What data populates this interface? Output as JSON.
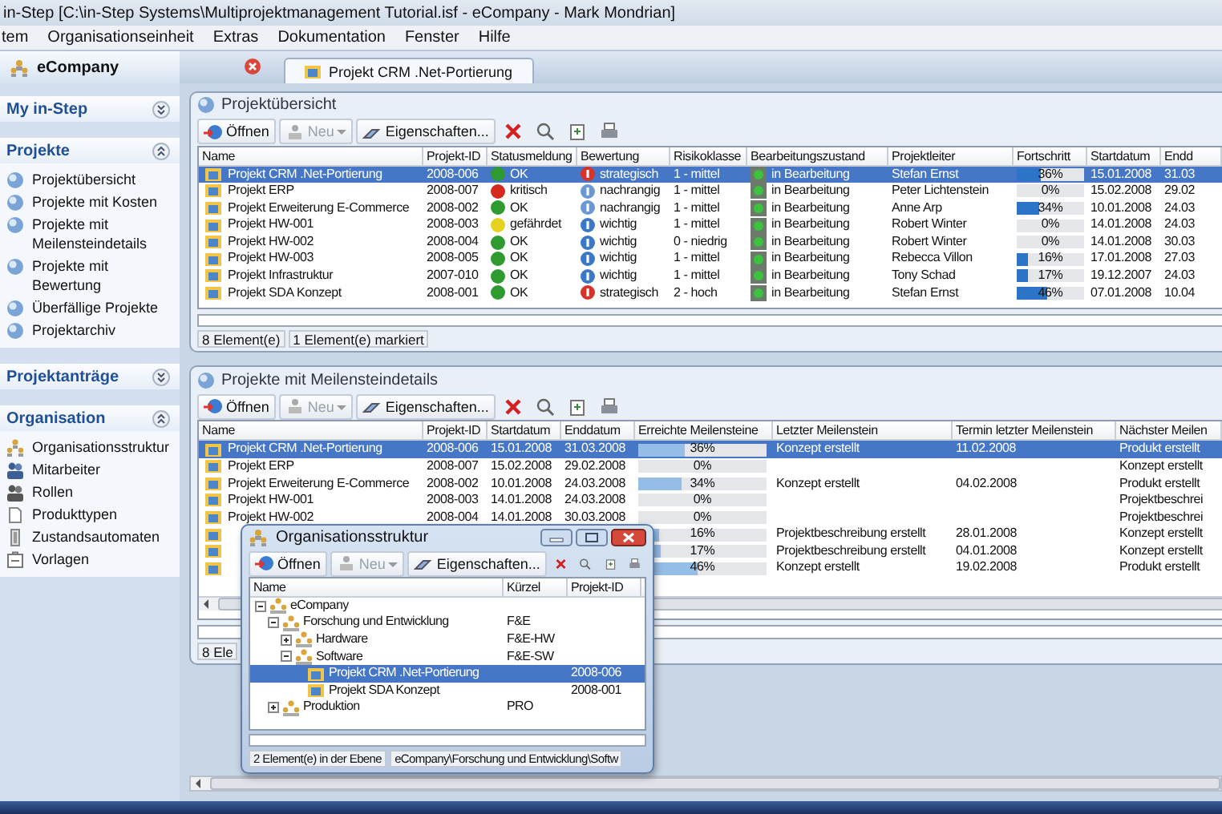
{
  "window": {
    "title": "in-Step  [C:\\in-Step Systems\\Multiprojektmanagement Tutorial.isf - eCompany - Mark Mondrian]"
  },
  "menu": [
    "tem",
    "Organisationseinheit",
    "Extras",
    "Dokumentation",
    "Fenster",
    "Hilfe"
  ],
  "sidebar": {
    "title": "eCompany",
    "sections": [
      {
        "title": "My in-Step",
        "expanded": false
      },
      {
        "title": "Projekte",
        "expanded": true,
        "items": [
          {
            "label": "Projektübersicht",
            "kind": "report"
          },
          {
            "label": "Projekte mit Kosten",
            "kind": "report"
          },
          {
            "label": "Projekte mit Meilensteindetails",
            "kind": "report"
          },
          {
            "label": "Projekte mit Bewertung",
            "kind": "report"
          },
          {
            "label": "Überfällige Projekte",
            "kind": "report"
          },
          {
            "label": "Projektarchiv",
            "kind": "report"
          }
        ]
      },
      {
        "title": "Projektanträge",
        "expanded": false
      },
      {
        "title": "Organisation",
        "expanded": true,
        "items": [
          {
            "label": "Organisationsstruktur",
            "kind": "org"
          },
          {
            "label": "Mitarbeiter",
            "kind": "people"
          },
          {
            "label": "Rollen",
            "kind": "roles"
          },
          {
            "label": "Produkttypen",
            "kind": "product"
          },
          {
            "label": "Zustandsautomaten",
            "kind": "automaton"
          },
          {
            "label": "Vorlagen",
            "kind": "template"
          }
        ]
      }
    ]
  },
  "tabs": [
    {
      "label": "Projekt CRM .Net-Portierung",
      "selected": true
    }
  ],
  "panels": [
    {
      "title": "Projektübersicht",
      "toolbar": [
        {
          "kind": "open",
          "label": "Öffnen",
          "disabled": false
        },
        {
          "kind": "new",
          "label": "Neu",
          "disabled": true
        },
        {
          "kind": "properties",
          "label": "Eigenschaften...",
          "disabled": false
        }
      ],
      "table": {
        "columns": [
          "Name",
          "Projekt-ID",
          "Statusmeldung",
          "Bewertung",
          "Risikoklasse",
          "Bearbeitungszustand",
          "Projektleiter",
          "Fortschritt",
          "Startdatum",
          "Endd"
        ],
        "rows": [
          {
            "name": "Projekt CRM .Net-Portierung",
            "id": "2008-006",
            "status": {
              "label": "OK",
              "color": "#2f9a2f"
            },
            "rating": {
              "label": "strategisch",
              "kind": "high"
            },
            "risk": "1 - mittel",
            "state": "in Bearbeitung",
            "lead": "Stefan Ernst",
            "progress": {
              "level": 0.36,
              "reading": "36%"
            },
            "start": "15.01.2008",
            "end": "31.03",
            "selected": true
          },
          {
            "name": "Projekt ERP",
            "id": "2008-007",
            "status": {
              "label": "kritisch",
              "color": "#d42a1e"
            },
            "rating": {
              "label": "nachrangig",
              "kind": "low"
            },
            "risk": "1 - mittel",
            "state": "in Bearbeitung",
            "lead": "Peter Lichtenstein",
            "progress": {
              "level": 0,
              "reading": "0%"
            },
            "start": "15.02.2008",
            "end": "29.02",
            "selected": false
          },
          {
            "name": "Projekt Erweiterung E-Commerce",
            "id": "2008-002",
            "status": {
              "label": "OK",
              "color": "#2f9a2f"
            },
            "rating": {
              "label": "nachrangig",
              "kind": "low"
            },
            "risk": "1 - mittel",
            "state": "in Bearbeitung",
            "lead": "Anne Arp",
            "progress": {
              "level": 0.34,
              "reading": "34%"
            },
            "start": "10.01.2008",
            "end": "24.03",
            "selected": false
          },
          {
            "name": "Projekt HW-001",
            "id": "2008-003",
            "status": {
              "label": "gefährdet",
              "color": "#e6d21e"
            },
            "rating": {
              "label": "wichtig",
              "kind": "medium"
            },
            "risk": "1 - mittel",
            "state": "in Bearbeitung",
            "lead": "Robert Winter",
            "progress": {
              "level": 0,
              "reading": "0%"
            },
            "start": "14.01.2008",
            "end": "24.03",
            "selected": false
          },
          {
            "name": "Projekt HW-002",
            "id": "2008-004",
            "status": {
              "label": "OK",
              "color": "#2f9a2f"
            },
            "rating": {
              "label": "wichtig",
              "kind": "medium"
            },
            "risk": "0 - niedrig",
            "state": "in Bearbeitung",
            "lead": "Robert Winter",
            "progress": {
              "level": 0,
              "reading": "0%"
            },
            "start": "14.01.2008",
            "end": "30.03",
            "selected": false
          },
          {
            "name": "Projekt HW-003",
            "id": "2008-005",
            "status": {
              "label": "OK",
              "color": "#2f9a2f"
            },
            "rating": {
              "label": "wichtig",
              "kind": "medium"
            },
            "risk": "1 - mittel",
            "state": "in Bearbeitung",
            "lead": "Rebecca Villon",
            "progress": {
              "level": 0.16,
              "reading": "16%"
            },
            "start": "17.01.2008",
            "end": "27.03",
            "selected": false
          },
          {
            "name": "Projekt Infrastruktur",
            "id": "2007-010",
            "status": {
              "label": "OK",
              "color": "#2f9a2f"
            },
            "rating": {
              "label": "wichtig",
              "kind": "medium"
            },
            "risk": "1 - mittel",
            "state": "in Bearbeitung",
            "lead": "Tony Schad",
            "progress": {
              "level": 0.17,
              "reading": "17%"
            },
            "start": "19.12.2007",
            "end": "24.03",
            "selected": false
          },
          {
            "name": "Projekt SDA Konzept",
            "id": "2008-001",
            "status": {
              "label": "OK",
              "color": "#2f9a2f"
            },
            "rating": {
              "label": "strategisch",
              "kind": "high"
            },
            "risk": "2 - hoch",
            "state": "in Bearbeitung",
            "lead": "Stefan Ernst",
            "progress": {
              "level": 0.46,
              "reading": "46%"
            },
            "start": "07.01.2008",
            "end": "10.04",
            "selected": false
          }
        ]
      },
      "status": [
        "8 Element(e)",
        "1 Element(e) markiert"
      ]
    },
    {
      "title": "Projekte mit Meilensteindetails",
      "toolbar": [
        {
          "kind": "open",
          "label": "Öffnen",
          "disabled": false
        },
        {
          "kind": "new",
          "label": "Neu",
          "disabled": true
        },
        {
          "kind": "properties",
          "label": "Eigenschaften...",
          "disabled": false
        }
      ],
      "table": {
        "columns": [
          "Name",
          "Projekt-ID",
          "Startdatum",
          "Enddatum",
          "Erreichte Meilensteine",
          "Letzter Meilenstein",
          "Termin letzter Meilenstein",
          "Nächster Meilen"
        ],
        "rows": [
          {
            "name": "Projekt CRM .Net-Portierung",
            "id": "2008-006",
            "start": "15.01.2008",
            "end": "31.03.2008",
            "milestones": {
              "level": 0.36,
              "reading": "36%"
            },
            "last": "Konzept erstellt",
            "last_date": "11.02.2008",
            "next": "Produkt erstellt",
            "selected": true
          },
          {
            "name": "Projekt ERP",
            "id": "2008-007",
            "start": "15.02.2008",
            "end": "29.02.2008",
            "milestones": {
              "level": 0,
              "reading": "0%"
            },
            "next": "Konzept erstellt",
            "selected": false
          },
          {
            "name": "Projekt Erweiterung E-Commerce",
            "id": "2008-002",
            "start": "10.01.2008",
            "end": "24.03.2008",
            "milestones": {
              "level": 0.34,
              "reading": "34%"
            },
            "last": "Konzept erstellt",
            "last_date": "04.02.2008",
            "next": "Produkt erstellt",
            "selected": false
          },
          {
            "name": "Projekt HW-001",
            "id": "2008-003",
            "start": "14.01.2008",
            "end": "24.03.2008",
            "milestones": {
              "level": 0,
              "reading": "0%"
            },
            "next": "Projektbeschrei",
            "selected": false
          },
          {
            "name": "Projekt HW-002",
            "id": "2008-004",
            "start": "14.01.2008",
            "end": "30.03.2008",
            "milestones": {
              "level": 0,
              "reading": "0%"
            },
            "next": "Projektbeschrei",
            "selected": false
          },
          {
            "milestones": {
              "level": 0.16,
              "reading": "16%"
            },
            "last": "Projektbeschreibung erstellt",
            "last_date": "28.01.2008",
            "next": "Konzept erstellt",
            "selected": false
          },
          {
            "milestones": {
              "level": 0.17,
              "reading": "17%"
            },
            "last": "Projektbeschreibung erstellt",
            "last_date": "04.01.2008",
            "next": "Konzept erstellt",
            "selected": false
          },
          {
            "milestones": {
              "level": 0.46,
              "reading": "46%"
            },
            "last": "Konzept erstellt",
            "last_date": "19.02.2008",
            "next": "Produkt erstellt",
            "selected": false
          }
        ]
      },
      "status": [
        "8 Ele"
      ]
    }
  ],
  "org_window": {
    "title": "Organisationsstruktur",
    "toolbar": [
      {
        "kind": "open",
        "label": "Öffnen",
        "disabled": false
      },
      {
        "kind": "new",
        "label": "Neu",
        "disabled": true
      },
      {
        "kind": "properties",
        "label": "Eigenschaften...",
        "disabled": false
      }
    ],
    "columns": [
      "Name",
      "Kürzel",
      "Projekt-ID"
    ],
    "tree": [
      {
        "label": "eCompany",
        "kind": "unit",
        "expanded": true,
        "selected": false,
        "children": [
          {
            "label": "Forschung und Entwicklung",
            "short": "F&E",
            "kind": "unit",
            "expanded": true,
            "selected": false,
            "children": [
              {
                "label": "Hardware",
                "short": "F&E-HW",
                "kind": "unit",
                "expanded": false,
                "selected": false
              },
              {
                "label": "Software",
                "short": "F&E-SW",
                "kind": "unit",
                "expanded": true,
                "selected": false,
                "children": [
                  {
                    "label": "Projekt CRM .Net-Portierung",
                    "id": "2008-006",
                    "kind": "project",
                    "selected": true
                  },
                  {
                    "label": "Projekt SDA Konzept",
                    "id": "2008-001",
                    "kind": "project",
                    "selected": false
                  }
                ]
              }
            ]
          },
          {
            "label": "Produktion",
            "short": "PRO",
            "kind": "unit",
            "expanded": false,
            "selected": false
          }
        ]
      }
    ],
    "status": [
      "2 Element(e) in der Ebene",
      "eCompany\\Forschung und Entwicklung\\Softw"
    ]
  }
}
